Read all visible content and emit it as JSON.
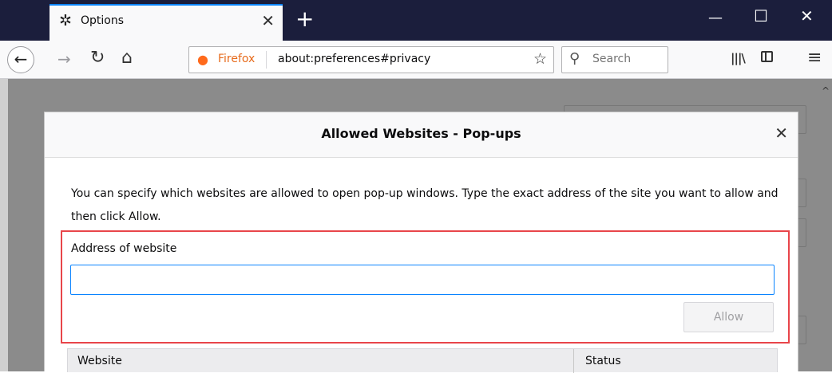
{
  "browser": {
    "tab": {
      "icon": "gear-icon",
      "title": "Options",
      "close_icon": "close-icon"
    },
    "new_tab_icon": "plus-icon",
    "window_controls": {
      "minimize": "minimize-icon",
      "maximize": "maximize-icon",
      "close": "close-icon"
    }
  },
  "navbar": {
    "back_icon": "back-arrow-icon",
    "forward_icon": "forward-arrow-icon",
    "reload_icon": "reload-icon",
    "home_icon": "home-icon",
    "identity_label": "Firefox",
    "url": "about:preferences#privacy",
    "bookmark_icon": "star-icon",
    "search_placeholder": "Search",
    "library_icon": "library-icon",
    "sidebar_icon": "sidebar-icon",
    "menu_icon": "hamburger-menu-icon"
  },
  "dialog": {
    "title": "Allowed Websites - Pop-ups",
    "close_icon": "close-icon",
    "description": "You can specify which websites are allowed to open pop-up windows. Type the exact address of the site you want to allow and then click Allow.",
    "address_label": "Address of website",
    "address_value": "",
    "allow_button": "Allow",
    "table": {
      "columns": [
        "Website",
        "Status"
      ]
    }
  },
  "colors": {
    "titlebar": "#1b1e3c",
    "accent": "#0a84ff",
    "highlight_border": "#e8454a",
    "overlay": "#8b8b8b"
  }
}
